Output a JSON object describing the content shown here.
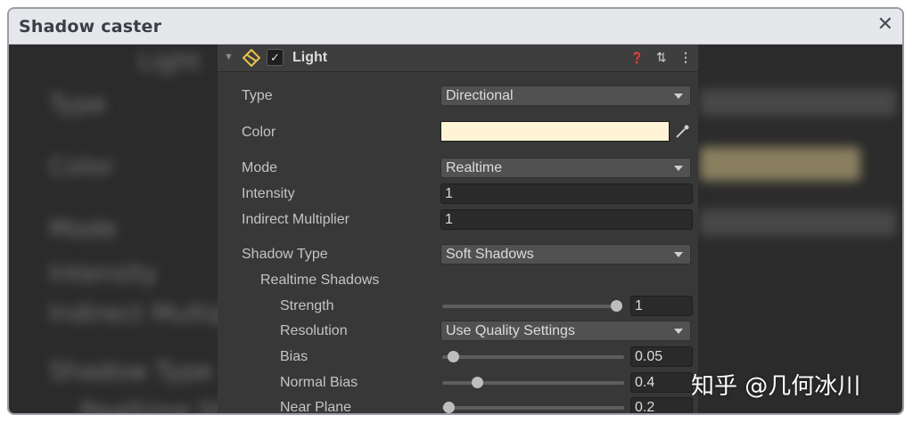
{
  "window": {
    "title": "Shadow caster",
    "close_glyph": "✕"
  },
  "component": {
    "name": "Light",
    "enabled": true,
    "check_glyph": "✓",
    "fold_glyph": "▼"
  },
  "header_icons": {
    "help": "❓",
    "presets": "⇅",
    "menu": "⋮"
  },
  "fields": {
    "type": {
      "label": "Type",
      "value": "Directional"
    },
    "color": {
      "label": "Color",
      "value": "#fff4d6"
    },
    "mode": {
      "label": "Mode",
      "value": "Realtime"
    },
    "intensity": {
      "label": "Intensity",
      "value": "1"
    },
    "indirect": {
      "label": "Indirect Multiplier",
      "value": "1"
    },
    "shadow_type": {
      "label": "Shadow Type",
      "value": "Soft Shadows"
    },
    "realtime_shadows": {
      "label": "Realtime Shadows"
    },
    "strength": {
      "label": "Strength",
      "value": "1",
      "level": 1.0
    },
    "resolution": {
      "label": "Resolution",
      "value": "Use Quality Settings"
    },
    "bias": {
      "label": "Bias",
      "value": "0.05",
      "level": 0.05
    },
    "normal_bias": {
      "label": "Normal Bias",
      "value": "0.4",
      "level": 0.2
    },
    "near_plane": {
      "label": "Near Plane",
      "value": "0.2",
      "level": 0.0
    }
  },
  "background_ghost": [
    "Light",
    "Type",
    "Color",
    "Mode",
    "Intensity",
    "Indirect Multipl",
    "Shadow Type",
    "Realtime Sh"
  ],
  "watermark": "知乎 @几何冰川"
}
